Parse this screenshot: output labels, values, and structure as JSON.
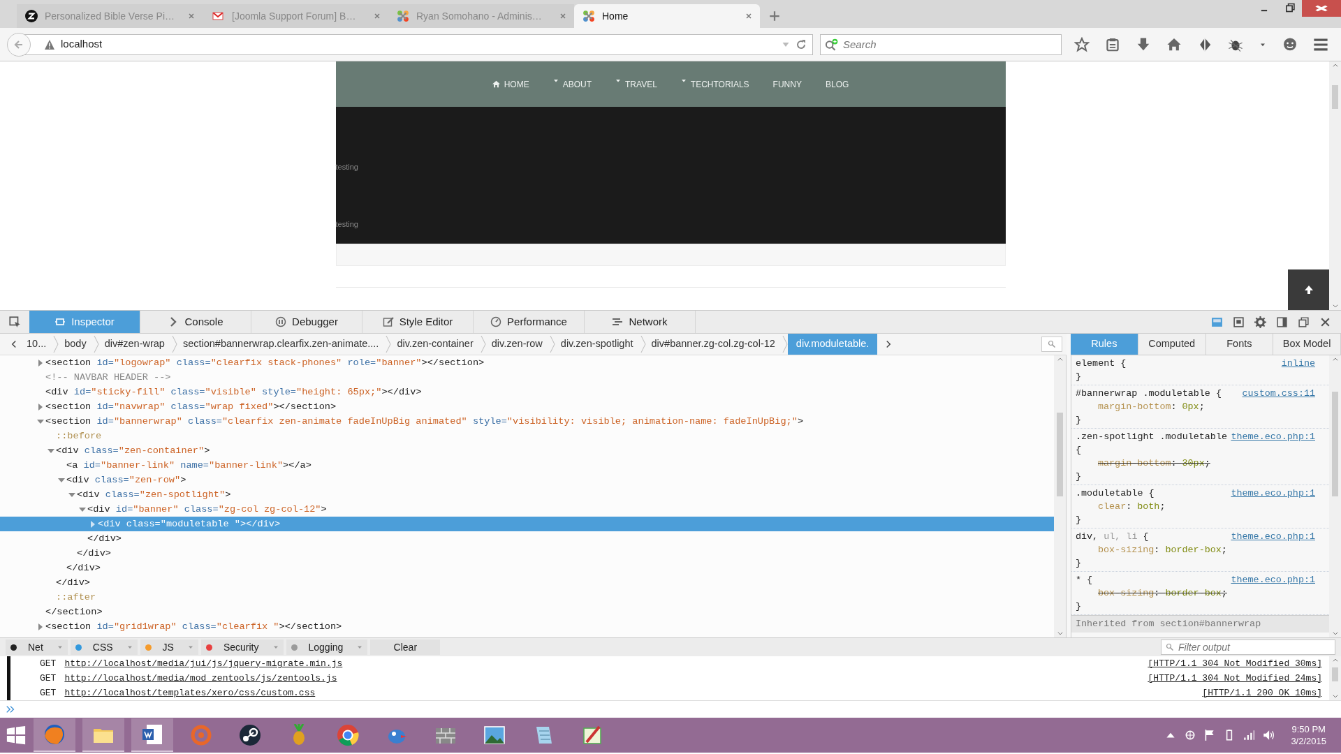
{
  "browser_tabs": [
    {
      "title": "Personalized Bible Verse Pi…",
      "selected": false
    },
    {
      "title": "[Joomla Support Forum] B…",
      "selected": false
    },
    {
      "title": "Ryan Somohano - Adminis…",
      "selected": false
    },
    {
      "title": "Home",
      "selected": true
    }
  ],
  "address_bar": {
    "value": "localhost"
  },
  "search_field": {
    "placeholder": "Search"
  },
  "site_nav": [
    {
      "label": "HOME",
      "dropdown": false
    },
    {
      "label": "ABOUT",
      "dropdown": true
    },
    {
      "label": "TRAVEL",
      "dropdown": true
    },
    {
      "label": "TECHTORIALS",
      "dropdown": true
    },
    {
      "label": "FUNNY",
      "dropdown": false
    },
    {
      "label": "BLOG",
      "dropdown": false
    }
  ],
  "banner_texts": [
    "testing",
    "testing"
  ],
  "devtools": {
    "tools": [
      {
        "label": "Inspector",
        "selected": true
      },
      {
        "label": "Console",
        "selected": false
      },
      {
        "label": "Debugger",
        "selected": false
      },
      {
        "label": "Style Editor",
        "selected": false
      },
      {
        "label": "Performance",
        "selected": false
      },
      {
        "label": "Network",
        "selected": false
      }
    ],
    "breadcrumbs": [
      {
        "label": "10...",
        "selected": false
      },
      {
        "label": "body",
        "selected": false
      },
      {
        "label": "div#zen-wrap",
        "selected": false
      },
      {
        "label": "section#bannerwrap.clearfix.zen-animate....",
        "selected": false
      },
      {
        "label": "div.zen-container",
        "selected": false
      },
      {
        "label": "div.zen-row",
        "selected": false
      },
      {
        "label": "div.zen-spotlight",
        "selected": false
      },
      {
        "label": "div#banner.zg-col.zg-col-12",
        "selected": false
      },
      {
        "label": "div.moduletable.",
        "selected": true
      }
    ],
    "markup": [
      {
        "kind": "element",
        "open": "<section id=\"logowrap\" class=\"clearfix stack-phones\" role=\"banner\">",
        "close": "</section>",
        "expanded": false,
        "selected": false
      },
      {
        "kind": "comment",
        "text": "<!-- NAVBAR HEADER -->"
      },
      {
        "kind": "element",
        "open": "<div id=\"sticky-fill\" class=\"visible\" style=\"height: 65px;\">",
        "close": "</div>",
        "selected": false
      },
      {
        "kind": "element",
        "open": "<section id=\"navwrap\" class=\"wrap fixed\">",
        "close": "</section>",
        "expanded": false,
        "selected": false
      },
      {
        "kind": "element",
        "open": "<section id=\"bannerwrap\" class=\"clearfix zen-animate fadeInUpBig animated\" style=\"visibility: visible; animation-name: fadeInUpBig;\">",
        "close": "</section>",
        "expanded": true,
        "selected": false,
        "children": [
          {
            "kind": "pseudo",
            "text": "::before"
          },
          {
            "kind": "element",
            "open": "<div class=\"zen-container\">",
            "close": "</div>",
            "expanded": true,
            "selected": false,
            "children": [
              {
                "kind": "element",
                "open": "<a id=\"banner-link\" name=\"banner-link\">",
                "close": "</a>",
                "selected": false
              },
              {
                "kind": "element",
                "open": "<div class=\"zen-row\">",
                "close": "</div>",
                "expanded": true,
                "selected": false,
                "children": [
                  {
                    "kind": "element",
                    "open": "<div class=\"zen-spotlight\">",
                    "close": "</div>",
                    "expanded": true,
                    "selected": false,
                    "children": [
                      {
                        "kind": "element",
                        "open": "<div id=\"banner\" class=\"zg-col zg-col-12\">",
                        "close": "</div>",
                        "expanded": true,
                        "selected": false,
                        "children": [
                          {
                            "kind": "element",
                            "open": "<div class=\"moduletable \">",
                            "close": "</div>",
                            "expanded": false,
                            "selected": true
                          }
                        ]
                      }
                    ]
                  }
                ]
              }
            ]
          },
          {
            "kind": "pseudo",
            "text": "::after"
          }
        ]
      },
      {
        "kind": "element",
        "open": "<section id=\"grid1wrap\" class=\"clearfix \">",
        "close": "</section>",
        "expanded": false,
        "selected": false
      }
    ],
    "side_tabs": [
      {
        "label": "Rules",
        "selected": true
      },
      {
        "label": "Computed",
        "selected": false
      },
      {
        "label": "Fonts",
        "selected": false
      },
      {
        "label": "Box Model",
        "selected": false
      }
    ],
    "rules": [
      {
        "selector": [
          {
            "text": "element {",
            "matched": true
          }
        ],
        "source": "inline",
        "close": "}"
      },
      {
        "selector": [
          {
            "text": "#bannerwrap .moduletable {",
            "matched": true
          }
        ],
        "source": "custom.css:11",
        "declarations": [
          {
            "text": "margin-bottom: 0px;",
            "overridden": false
          }
        ],
        "close": "}"
      },
      {
        "selector": [
          {
            "text": ".zen-spotlight .moduletable {",
            "matched": true
          }
        ],
        "source": "theme.eco.php:1",
        "declarations": [
          {
            "text": "margin-bottom: 30px;",
            "overridden": true
          }
        ],
        "close": "}"
      },
      {
        "selector": [
          {
            "text": ".moduletable {",
            "matched": true
          }
        ],
        "source": "theme.eco.php:1",
        "declarations": [
          {
            "text": "clear: both;",
            "overridden": false
          }
        ],
        "close": "}"
      },
      {
        "selector": [
          {
            "text": "div,",
            "matched": true
          },
          {
            "text": "ul,",
            "matched": false
          },
          {
            "text": "li",
            "matched": false
          },
          {
            "text": "{",
            "matched": true
          }
        ],
        "source": "theme.eco.php:1",
        "declarations": [
          {
            "text": "box-sizing: border-box;",
            "overridden": false
          }
        ],
        "close": "}"
      },
      {
        "selector": [
          {
            "text": "* {",
            "matched": true
          }
        ],
        "source": "theme.eco.php:1",
        "declarations": [
          {
            "text": "box-sizing: border-box;",
            "overridden": true
          }
        ],
        "close": "}"
      }
    ],
    "inherited": "Inherited from section#bannerwrap",
    "console_filters": [
      {
        "label": "Net",
        "color": "#222222"
      },
      {
        "label": "CSS",
        "color": "#3399dd"
      },
      {
        "label": "JS",
        "color": "#f59b2b"
      },
      {
        "label": "Security",
        "color": "#e84040"
      },
      {
        "label": "Logging",
        "color": "#9a9a9a"
      }
    ],
    "clear_button": "Clear",
    "filter_field": {
      "placeholder": "Filter output"
    },
    "console_log": [
      {
        "method": "GET",
        "url": "http://localhost/media/jui/js/jquery-migrate.min.js",
        "status": "[HTTP/1.1 304 Not Modified 30ms]"
      },
      {
        "method": "GET",
        "url": "http://localhost/media/mod_zentools/js/zentools.js",
        "status": "[HTTP/1.1 304 Not Modified 24ms]"
      },
      {
        "method": "GET",
        "url": "http://localhost/templates/xero/css/custom.css",
        "status": "[HTTP/1.1 200 OK 10ms]"
      }
    ]
  },
  "taskbar": {
    "time": "9:50 PM",
    "date": "3/2/2015"
  }
}
